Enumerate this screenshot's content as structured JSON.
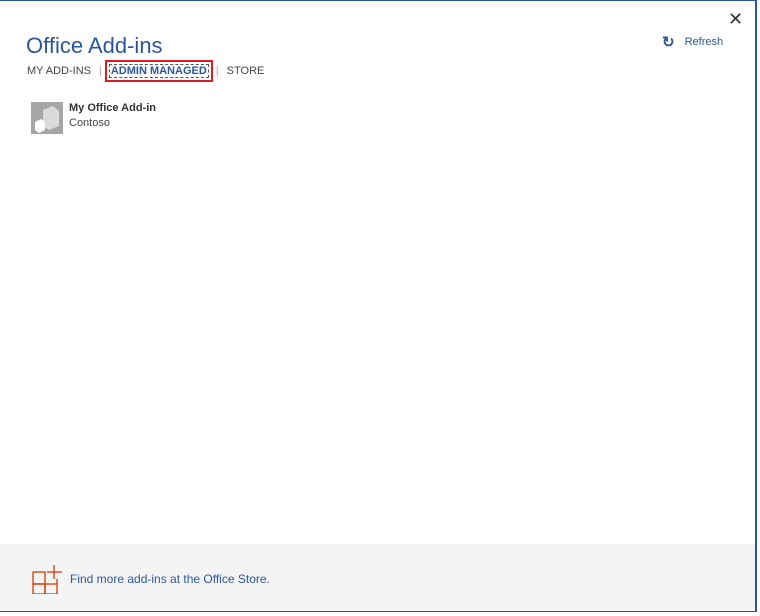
{
  "dialog": {
    "title": "Office Add-ins",
    "close_icon": "close-icon"
  },
  "toolbar": {
    "refresh_label": "Refresh",
    "refresh_icon": "refresh-icon"
  },
  "tabs": [
    {
      "label": "MY ADD-INS"
    },
    {
      "label": "ADMIN MANAGED",
      "active": true
    },
    {
      "label": "STORE"
    }
  ],
  "addins": [
    {
      "name": "My Office Add-in",
      "publisher": "Contoso"
    }
  ],
  "footer": {
    "store_link": "Find more add-ins at the Office Store.",
    "accent": "#d83b01"
  },
  "colors": {
    "brand": "#2b579a",
    "highlight": "#e01b24"
  }
}
